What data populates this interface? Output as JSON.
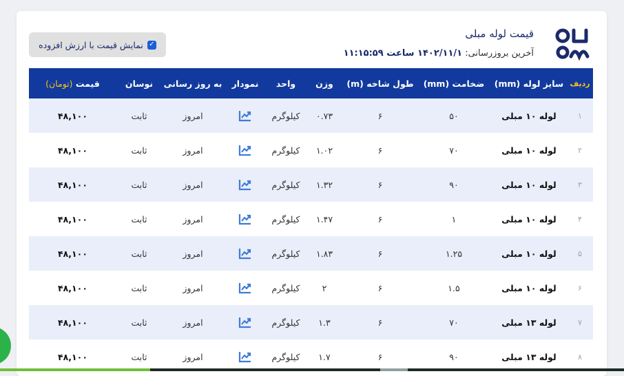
{
  "header": {
    "title": "قیمت لوله مبلی",
    "updated_label": "آخرین بروزرسانی:",
    "updated_value": "۱۴۰۲/۱۱/۱ ساعت ۱۱:۱۵:۵۹",
    "vat_toggle_label": "نمایش قیمت با ارزش افزوده",
    "vat_checked": true
  },
  "colors": {
    "header_bg": "#123a9e",
    "accent_gold": "#f5c518",
    "row_alt": "#e9eefa",
    "checkbox": "#1a5fd6"
  },
  "table": {
    "headers": {
      "index": "ردیف",
      "size": "سایز لوله (mm)",
      "thickness": "ضخامت (mm)",
      "length": "طول شاخه (m)",
      "weight": "وزن",
      "unit": "واحد",
      "chart": "نمودار",
      "updated": "به روز رسانی",
      "change": "نوسان",
      "price": "قیمت",
      "price_unit": "(تومان)"
    },
    "rows": [
      {
        "index": "۱",
        "size": "لوله ۱۰ مبلی",
        "thickness": "۵۰",
        "length": "۶",
        "weight": "۰.۷۳",
        "unit": "کیلوگرم",
        "chart_icon": "chart-trend-icon",
        "updated": "امروز",
        "change": "ثابت",
        "price": "۴۸,۱۰۰"
      },
      {
        "index": "۲",
        "size": "لوله ۱۰ مبلی",
        "thickness": "۷۰",
        "length": "۶",
        "weight": "۱.۰۲",
        "unit": "کیلوگرم",
        "chart_icon": "chart-trend-icon",
        "updated": "امروز",
        "change": "ثابت",
        "price": "۴۸,۱۰۰"
      },
      {
        "index": "۳",
        "size": "لوله ۱۰ مبلی",
        "thickness": "۹۰",
        "length": "۶",
        "weight": "۱.۳۲",
        "unit": "کیلوگرم",
        "chart_icon": "chart-trend-icon",
        "updated": "امروز",
        "change": "ثابت",
        "price": "۴۸,۱۰۰"
      },
      {
        "index": "۴",
        "size": "لوله ۱۰ مبلی",
        "thickness": "۱",
        "length": "۶",
        "weight": "۱.۴۷",
        "unit": "کیلوگرم",
        "chart_icon": "chart-trend-icon",
        "updated": "امروز",
        "change": "ثابت",
        "price": "۴۸,۱۰۰"
      },
      {
        "index": "۵",
        "size": "لوله ۱۰ مبلی",
        "thickness": "۱.۲۵",
        "length": "۶",
        "weight": "۱.۸۳",
        "unit": "کیلوگرم",
        "chart_icon": "chart-trend-icon",
        "updated": "امروز",
        "change": "ثابت",
        "price": "۴۸,۱۰۰"
      },
      {
        "index": "۶",
        "size": "لوله ۱۰ مبلی",
        "thickness": "۱.۵",
        "length": "۶",
        "weight": "۲",
        "unit": "کیلوگرم",
        "chart_icon": "chart-trend-icon",
        "updated": "امروز",
        "change": "ثابت",
        "price": "۴۸,۱۰۰"
      },
      {
        "index": "۷",
        "size": "لوله ۱۳ مبلی",
        "thickness": "۷۰",
        "length": "۶",
        "weight": "۱.۳",
        "unit": "کیلوگرم",
        "chart_icon": "chart-trend-icon",
        "updated": "امروز",
        "change": "ثابت",
        "price": "۴۸,۱۰۰"
      },
      {
        "index": "۸",
        "size": "لوله ۱۳ مبلی",
        "thickness": "۹۰",
        "length": "۶",
        "weight": "۱.۷",
        "unit": "کیلوگرم",
        "chart_icon": "chart-trend-icon",
        "updated": "امروز",
        "change": "ثابت",
        "price": "۴۸,۱۰۰"
      }
    ]
  }
}
